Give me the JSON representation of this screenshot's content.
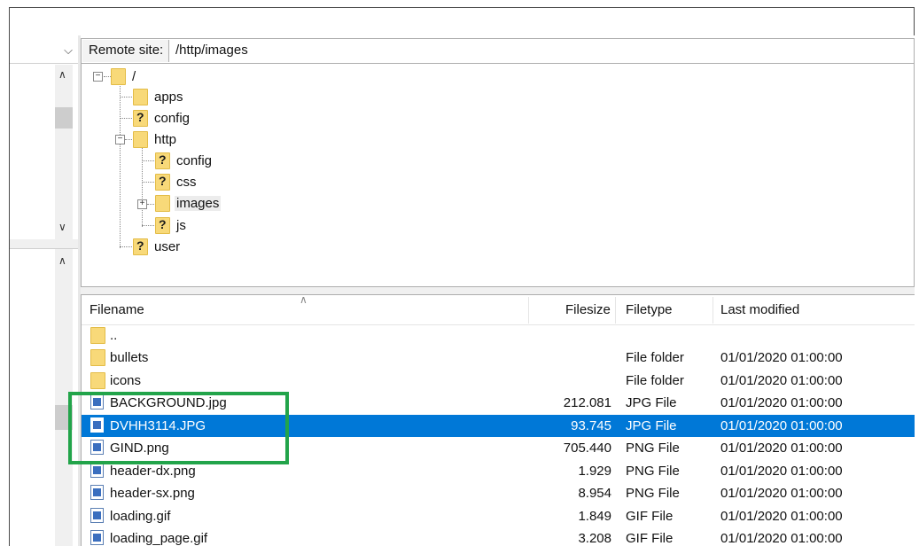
{
  "remote_site": {
    "label": "Remote site:",
    "path": "/http/images"
  },
  "tree": {
    "root": "/",
    "apps": "apps",
    "config": "config",
    "http": "http",
    "http_config": "config",
    "http_css": "css",
    "http_images": "images",
    "http_js": "js",
    "user": "user"
  },
  "list": {
    "columns": {
      "filename": "Filename",
      "filesize": "Filesize",
      "filetype": "Filetype",
      "last_modified": "Last modified"
    },
    "rows": [
      {
        "name": "..",
        "size": "",
        "type": "",
        "modified": ""
      },
      {
        "name": "bullets",
        "size": "",
        "type": "File folder",
        "modified": "01/01/2020 01:00:00"
      },
      {
        "name": "icons",
        "size": "",
        "type": "File folder",
        "modified": "01/01/2020 01:00:00"
      },
      {
        "name": "BACKGROUND.jpg",
        "size": "212.081",
        "type": "JPG File",
        "modified": "01/01/2020 01:00:00"
      },
      {
        "name": "DVHH3114.JPG",
        "size": "93.745",
        "type": "JPG File",
        "modified": "01/01/2020 01:00:00"
      },
      {
        "name": "GIND.png",
        "size": "705.440",
        "type": "PNG File",
        "modified": "01/01/2020 01:00:00"
      },
      {
        "name": "header-dx.png",
        "size": "1.929",
        "type": "PNG File",
        "modified": "01/01/2020 01:00:00"
      },
      {
        "name": "header-sx.png",
        "size": "8.954",
        "type": "PNG File",
        "modified": "01/01/2020 01:00:00"
      },
      {
        "name": "loading.gif",
        "size": "1.849",
        "type": "GIF File",
        "modified": "01/01/2020 01:00:00"
      },
      {
        "name": "loading_page.gif",
        "size": "3.208",
        "type": "GIF File",
        "modified": "01/01/2020 01:00:00"
      }
    ]
  },
  "colors": {
    "selection": "#0078d7",
    "highlight": "#22a44a",
    "folder": "#f8d979"
  }
}
